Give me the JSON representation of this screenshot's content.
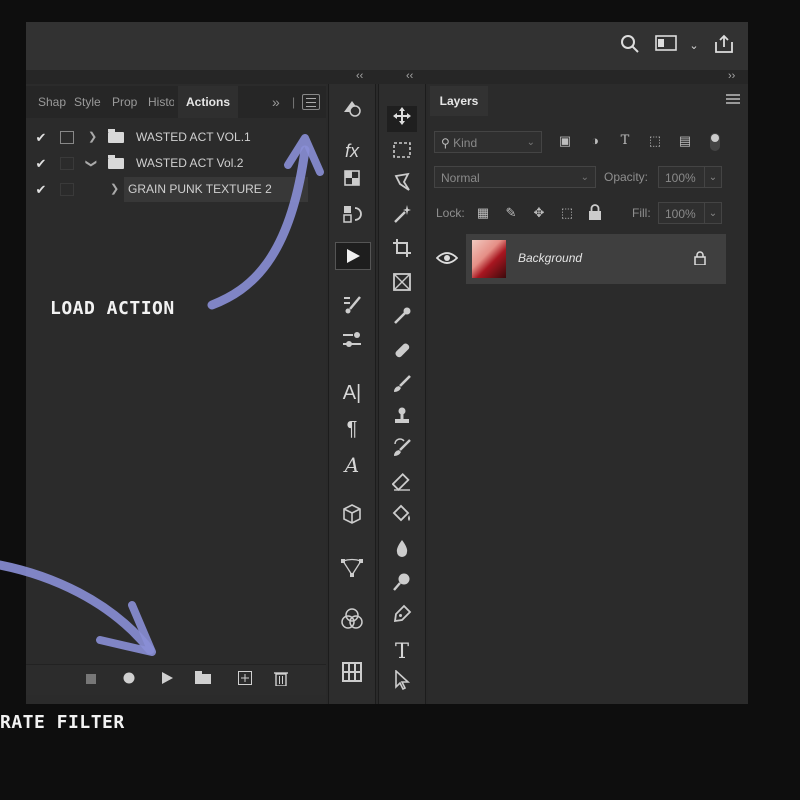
{
  "topbar": {
    "search_icon": "search-icon",
    "workspace_icon": "workspace-icon",
    "chevron_icon": "chevron-down-icon",
    "share_icon": "share-icon"
  },
  "collapse": {
    "left": "‹‹",
    "middle": "‹‹",
    "right": "››"
  },
  "actions_panel": {
    "tabs": [
      "Shap",
      "Style",
      "Prop",
      "Histo",
      "Actions"
    ],
    "expand": "»",
    "items": [
      {
        "label": "WASTED ACT VOL.1",
        "checked": true,
        "expanded": false
      },
      {
        "label": "WASTED ACT Vol.2",
        "checked": true,
        "expanded": true
      },
      {
        "label": "GRAIN PUNK TEXTURE 2",
        "checked": true,
        "expanded": false
      }
    ],
    "bottom_buttons": [
      "stop-icon",
      "record-icon",
      "play-icon",
      "folder-icon",
      "new-action-icon",
      "trash-icon"
    ]
  },
  "side_strip": {
    "tools": [
      "history-icon",
      "fx-icon",
      "3d-icon",
      "adjust-icon",
      "play-icon",
      "brush-settings-icon",
      "brush-presets-icon",
      "character-icon",
      "paragraph-icon",
      "glyphs-icon",
      "3d-cube-icon",
      "paths-icon",
      "channels-icon",
      "grid-icon"
    ],
    "labels": {
      "character": "A|",
      "paragraph": "¶",
      "glyphs": "𝒜",
      "fx": "fx"
    }
  },
  "toolbar": {
    "tools": [
      "move-tool-icon",
      "marquee-tool-icon",
      "lasso-tool-icon",
      "magic-wand-icon",
      "crop-tool-icon",
      "frame-tool-icon",
      "eyedropper-icon",
      "healing-brush-icon",
      "brush-tool-icon",
      "clone-stamp-icon",
      "history-brush-icon",
      "eraser-icon",
      "paint-bucket-icon",
      "blur-tool-icon",
      "dodge-tool-icon",
      "pen-tool-icon",
      "type-tool-icon",
      "path-selection-icon"
    ],
    "type_label": "T"
  },
  "layers_panel": {
    "tab": "Layers",
    "filter_kind": "Kind",
    "blend_mode": "Normal",
    "opacity_label": "Opacity:",
    "opacity_value": "100%",
    "lock_label": "Lock:",
    "fill_label": "Fill:",
    "fill_value": "100%",
    "layers": [
      {
        "name": "Background",
        "visible": true,
        "locked": true
      }
    ]
  },
  "annotations": {
    "load_action": "LOAD ACTION",
    "generate_filter": "RATE FILTER",
    "arrow_color": "#8a8fd6"
  }
}
